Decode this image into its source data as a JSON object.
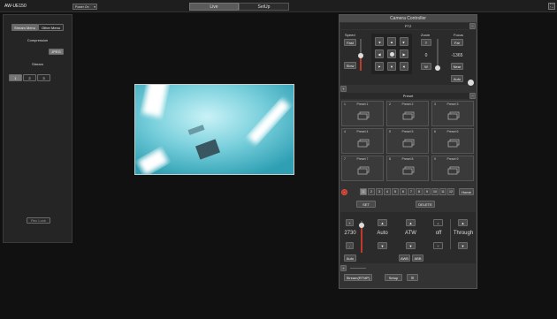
{
  "app": {
    "title": "AW-UE150",
    "power_label": "Power On",
    "power_arrow": "▾",
    "tabs": [
      "Live",
      "SetUp"
    ],
    "window_icon": "⛶"
  },
  "left": {
    "menu_tabs": [
      "Stream Menu",
      "Other Menu"
    ],
    "compression_label": "Compression",
    "compression_value": "JPEG",
    "stream_label": "Stream",
    "streams": [
      "1",
      "2",
      "3"
    ],
    "bottom_button": "Rec Lock"
  },
  "camera_controller": {
    "title": "Camera Controller",
    "ptz": {
      "title": "PTZ",
      "speed_label": "Speed",
      "fast_label": "Fast",
      "slow_label": "Slow",
      "zoom_label": "Zoom",
      "zoom_t": "T",
      "zoom_value": "0",
      "zoom_w": "W",
      "focus_label": "Focus",
      "focus_far": "Far",
      "focus_value": "-1365",
      "focus_near": "Near",
      "focus_auto": "Auto"
    },
    "preset": {
      "title": "Preset",
      "items": [
        {
          "num": "1",
          "name": "Preset 1"
        },
        {
          "num": "2",
          "name": "Preset 2"
        },
        {
          "num": "3",
          "name": "Preset 3"
        },
        {
          "num": "4",
          "name": "Preset 4"
        },
        {
          "num": "5",
          "name": "Preset 5"
        },
        {
          "num": "6",
          "name": "Preset 6"
        },
        {
          "num": "7",
          "name": "Preset 7"
        },
        {
          "num": "8",
          "name": "Preset 8"
        },
        {
          "num": "9",
          "name": "Preset 9"
        }
      ],
      "pages": [
        "1",
        "2",
        "3",
        "4",
        "5",
        "6",
        "7",
        "8",
        "9",
        "10",
        "11",
        "12"
      ],
      "active_page": "1",
      "home_label": "Home",
      "set_label": "SET",
      "delete_label": "DELETE"
    },
    "image": {
      "iris_value": "2730",
      "iris_plus": "+",
      "iris_minus": "-",
      "iris_auto": "Auto",
      "gain_value": "Auto",
      "wb_value": "ATW",
      "awb_label": "AWB",
      "abb_label": "ABB",
      "shutter_value": "off",
      "scene_value": "Through"
    },
    "footer": {
      "buttons": [
        "Stream(RTMP)",
        "Setup",
        "☰"
      ]
    }
  },
  "icons": {
    "up": "▲",
    "down": "▼",
    "left": "◀",
    "right": "▶",
    "plus": "+",
    "minus": "−"
  }
}
